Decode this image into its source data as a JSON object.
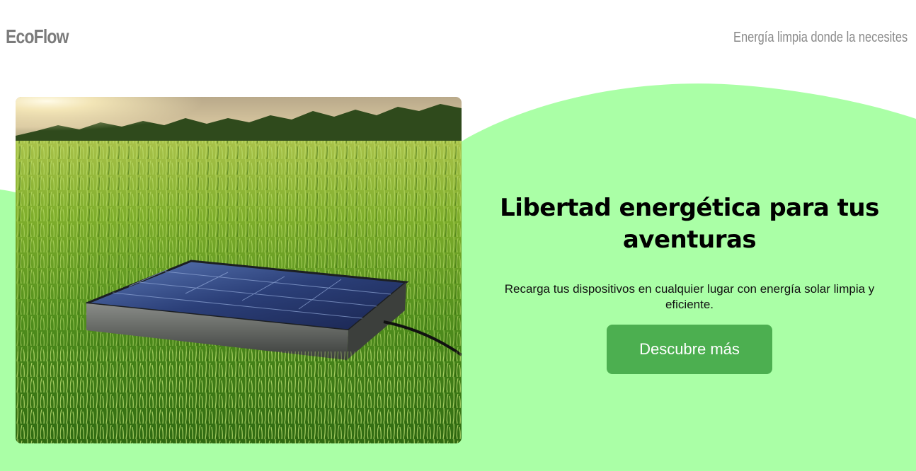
{
  "header": {
    "brand": "EcoFlow",
    "tagline": "Energía limpia donde la necesites"
  },
  "hero": {
    "title": "Libertad energética para tus aventuras",
    "description": "Recarga tus dispositivos en cualquier lugar con energía solar limpia y eficiente.",
    "cta_label": "Descubre más",
    "image_icon": "solar-panel-in-grass-photo"
  },
  "colors": {
    "wave_green": "#aaffa6",
    "button_green": "#4caf50",
    "brand_gray": "#7b7b7b",
    "tagline_gray": "#8a8a8a"
  }
}
